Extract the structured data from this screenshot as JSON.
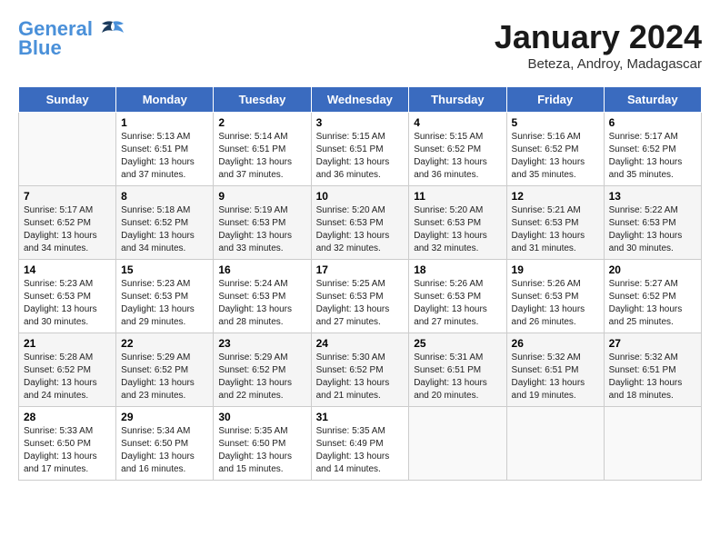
{
  "header": {
    "logo_line1": "General",
    "logo_line2": "Blue",
    "month": "January 2024",
    "location": "Beteza, Androy, Madagascar"
  },
  "weekdays": [
    "Sunday",
    "Monday",
    "Tuesday",
    "Wednesday",
    "Thursday",
    "Friday",
    "Saturday"
  ],
  "weeks": [
    [
      {
        "num": "",
        "info": ""
      },
      {
        "num": "1",
        "info": "Sunrise: 5:13 AM\nSunset: 6:51 PM\nDaylight: 13 hours\nand 37 minutes."
      },
      {
        "num": "2",
        "info": "Sunrise: 5:14 AM\nSunset: 6:51 PM\nDaylight: 13 hours\nand 37 minutes."
      },
      {
        "num": "3",
        "info": "Sunrise: 5:15 AM\nSunset: 6:51 PM\nDaylight: 13 hours\nand 36 minutes."
      },
      {
        "num": "4",
        "info": "Sunrise: 5:15 AM\nSunset: 6:52 PM\nDaylight: 13 hours\nand 36 minutes."
      },
      {
        "num": "5",
        "info": "Sunrise: 5:16 AM\nSunset: 6:52 PM\nDaylight: 13 hours\nand 35 minutes."
      },
      {
        "num": "6",
        "info": "Sunrise: 5:17 AM\nSunset: 6:52 PM\nDaylight: 13 hours\nand 35 minutes."
      }
    ],
    [
      {
        "num": "7",
        "info": "Sunrise: 5:17 AM\nSunset: 6:52 PM\nDaylight: 13 hours\nand 34 minutes."
      },
      {
        "num": "8",
        "info": "Sunrise: 5:18 AM\nSunset: 6:52 PM\nDaylight: 13 hours\nand 34 minutes."
      },
      {
        "num": "9",
        "info": "Sunrise: 5:19 AM\nSunset: 6:53 PM\nDaylight: 13 hours\nand 33 minutes."
      },
      {
        "num": "10",
        "info": "Sunrise: 5:20 AM\nSunset: 6:53 PM\nDaylight: 13 hours\nand 32 minutes."
      },
      {
        "num": "11",
        "info": "Sunrise: 5:20 AM\nSunset: 6:53 PM\nDaylight: 13 hours\nand 32 minutes."
      },
      {
        "num": "12",
        "info": "Sunrise: 5:21 AM\nSunset: 6:53 PM\nDaylight: 13 hours\nand 31 minutes."
      },
      {
        "num": "13",
        "info": "Sunrise: 5:22 AM\nSunset: 6:53 PM\nDaylight: 13 hours\nand 30 minutes."
      }
    ],
    [
      {
        "num": "14",
        "info": "Sunrise: 5:23 AM\nSunset: 6:53 PM\nDaylight: 13 hours\nand 30 minutes."
      },
      {
        "num": "15",
        "info": "Sunrise: 5:23 AM\nSunset: 6:53 PM\nDaylight: 13 hours\nand 29 minutes."
      },
      {
        "num": "16",
        "info": "Sunrise: 5:24 AM\nSunset: 6:53 PM\nDaylight: 13 hours\nand 28 minutes."
      },
      {
        "num": "17",
        "info": "Sunrise: 5:25 AM\nSunset: 6:53 PM\nDaylight: 13 hours\nand 27 minutes."
      },
      {
        "num": "18",
        "info": "Sunrise: 5:26 AM\nSunset: 6:53 PM\nDaylight: 13 hours\nand 27 minutes."
      },
      {
        "num": "19",
        "info": "Sunrise: 5:26 AM\nSunset: 6:53 PM\nDaylight: 13 hours\nand 26 minutes."
      },
      {
        "num": "20",
        "info": "Sunrise: 5:27 AM\nSunset: 6:52 PM\nDaylight: 13 hours\nand 25 minutes."
      }
    ],
    [
      {
        "num": "21",
        "info": "Sunrise: 5:28 AM\nSunset: 6:52 PM\nDaylight: 13 hours\nand 24 minutes."
      },
      {
        "num": "22",
        "info": "Sunrise: 5:29 AM\nSunset: 6:52 PM\nDaylight: 13 hours\nand 23 minutes."
      },
      {
        "num": "23",
        "info": "Sunrise: 5:29 AM\nSunset: 6:52 PM\nDaylight: 13 hours\nand 22 minutes."
      },
      {
        "num": "24",
        "info": "Sunrise: 5:30 AM\nSunset: 6:52 PM\nDaylight: 13 hours\nand 21 minutes."
      },
      {
        "num": "25",
        "info": "Sunrise: 5:31 AM\nSunset: 6:51 PM\nDaylight: 13 hours\nand 20 minutes."
      },
      {
        "num": "26",
        "info": "Sunrise: 5:32 AM\nSunset: 6:51 PM\nDaylight: 13 hours\nand 19 minutes."
      },
      {
        "num": "27",
        "info": "Sunrise: 5:32 AM\nSunset: 6:51 PM\nDaylight: 13 hours\nand 18 minutes."
      }
    ],
    [
      {
        "num": "28",
        "info": "Sunrise: 5:33 AM\nSunset: 6:50 PM\nDaylight: 13 hours\nand 17 minutes."
      },
      {
        "num": "29",
        "info": "Sunrise: 5:34 AM\nSunset: 6:50 PM\nDaylight: 13 hours\nand 16 minutes."
      },
      {
        "num": "30",
        "info": "Sunrise: 5:35 AM\nSunset: 6:50 PM\nDaylight: 13 hours\nand 15 minutes."
      },
      {
        "num": "31",
        "info": "Sunrise: 5:35 AM\nSunset: 6:49 PM\nDaylight: 13 hours\nand 14 minutes."
      },
      {
        "num": "",
        "info": ""
      },
      {
        "num": "",
        "info": ""
      },
      {
        "num": "",
        "info": ""
      }
    ]
  ]
}
